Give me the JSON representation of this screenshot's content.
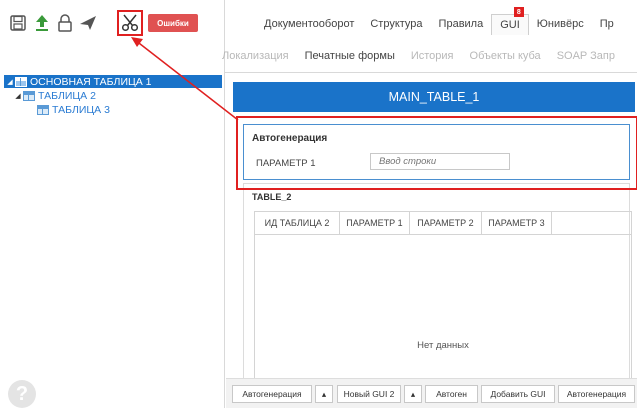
{
  "toolbar": {
    "errors_label": "Ошибки",
    "icons": [
      "save-icon",
      "upload-icon",
      "lock-icon",
      "send-icon",
      "scissors-icon"
    ]
  },
  "nav": {
    "tabs": [
      {
        "label": "Документооборот"
      },
      {
        "label": "Структура"
      },
      {
        "label": "Правила"
      },
      {
        "label": "GUI",
        "badge": "8"
      },
      {
        "label": "Юнивёрс"
      },
      {
        "label": "Пр"
      }
    ],
    "subtabs": [
      {
        "label": "Локализация"
      },
      {
        "label": "Печатные формы"
      },
      {
        "label": "История"
      },
      {
        "label": "Объекты куба"
      },
      {
        "label": "SOAP Запр"
      }
    ]
  },
  "tree": {
    "items": [
      {
        "label": "ОСНОВНАЯ ТАБЛИЦА 1"
      },
      {
        "label": "ТАБЛИЦА 2"
      },
      {
        "label": "ТАБЛИЦА 3"
      }
    ]
  },
  "main": {
    "header": "MAIN_TABLE_1",
    "autogen": {
      "title": "Автогенерация",
      "param_label": "ПАРАМЕТР 1",
      "param_placeholder": "Ввод строки"
    },
    "table": {
      "title": "TABLE_2",
      "columns": [
        "ИД ТАБЛИЦА 2",
        "ПАРАМЕТР 1",
        "ПАРАМЕТР 2",
        "ПАРАМЕТР 3"
      ],
      "empty_text": "Нет данных"
    }
  },
  "bottom": {
    "buttons": [
      "Автогенерация",
      "▴",
      "Новый GUI 2",
      "▴",
      "Автоген",
      "Добавить GUI",
      "Автогенерация"
    ]
  },
  "colors": {
    "accent": "#1a73c9",
    "highlight": "#e02020",
    "errors": "#e05252"
  }
}
